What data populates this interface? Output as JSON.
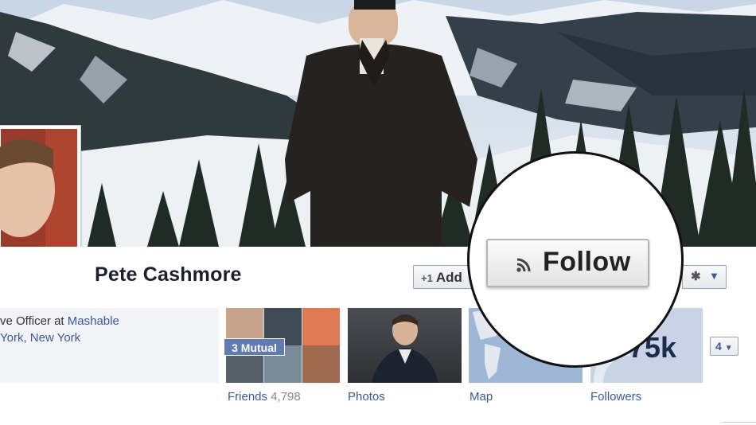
{
  "profile": {
    "name": "Pete Cashmore",
    "bio_line1_prefix": "ve Officer at ",
    "bio_company": "Mashable",
    "bio_line2": "York, New York"
  },
  "actions": {
    "add_label": "Add",
    "follow_label": "Follow",
    "more_label": "4"
  },
  "tiles": {
    "friends": {
      "label": "Friends",
      "count": "4,798",
      "badge": "3 Mutual"
    },
    "photos": {
      "label": "Photos"
    },
    "map": {
      "label": "Map"
    },
    "followers": {
      "label": "Followers",
      "number_visible": "75k"
    }
  },
  "icons": {
    "add": "plus-icon",
    "settings": "gear-icon",
    "dropdown": "chevron-down-icon",
    "follow": "rss-icon"
  },
  "colors": {
    "link_blue": "#3b5998",
    "name_text": "#1c1f2b",
    "badge_blue": "#5f7bb0"
  }
}
